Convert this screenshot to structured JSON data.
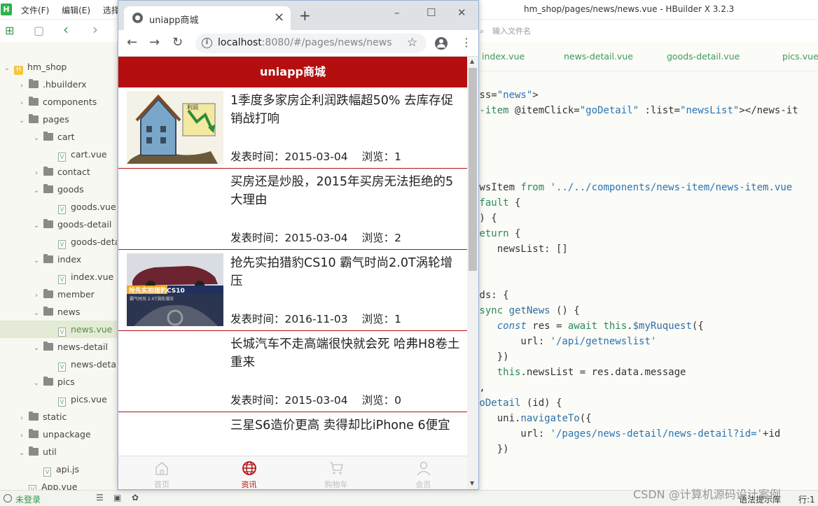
{
  "ide": {
    "menu": [
      "文件(F)",
      "编辑(E)",
      "选择(S"
    ],
    "window_title": "hm_shop/pages/news/news.vue - HBuilder X 3.2.3",
    "file_search_placeholder": "输入文件名",
    "tree": [
      {
        "label": "hm_shop",
        "type": "project",
        "depth": 0,
        "arrow": "open"
      },
      {
        "label": ".hbuilderx",
        "type": "folder",
        "depth": 1,
        "arrow": "closed"
      },
      {
        "label": "components",
        "type": "folder",
        "depth": 1,
        "arrow": "closed"
      },
      {
        "label": "pages",
        "type": "folder",
        "depth": 1,
        "arrow": "open"
      },
      {
        "label": "cart",
        "type": "folder",
        "depth": 2,
        "arrow": "open"
      },
      {
        "label": "cart.vue",
        "type": "file",
        "depth": 3
      },
      {
        "label": "contact",
        "type": "folder",
        "depth": 2,
        "arrow": "closed"
      },
      {
        "label": "goods",
        "type": "folder",
        "depth": 2,
        "arrow": "open"
      },
      {
        "label": "goods.vue",
        "type": "file",
        "depth": 3
      },
      {
        "label": "goods-detail",
        "type": "folder",
        "depth": 2,
        "arrow": "open"
      },
      {
        "label": "goods-deta",
        "type": "file",
        "depth": 3
      },
      {
        "label": "index",
        "type": "folder",
        "depth": 2,
        "arrow": "open"
      },
      {
        "label": "index.vue",
        "type": "file",
        "depth": 3
      },
      {
        "label": "member",
        "type": "folder",
        "depth": 2,
        "arrow": "closed"
      },
      {
        "label": "news",
        "type": "folder",
        "depth": 2,
        "arrow": "open"
      },
      {
        "label": "news.vue",
        "type": "file",
        "depth": 3,
        "selected": true
      },
      {
        "label": "news-detail",
        "type": "folder",
        "depth": 2,
        "arrow": "open"
      },
      {
        "label": "news-detail",
        "type": "file",
        "depth": 3
      },
      {
        "label": "pics",
        "type": "folder",
        "depth": 2,
        "arrow": "open"
      },
      {
        "label": "pics.vue",
        "type": "file",
        "depth": 3
      },
      {
        "label": "static",
        "type": "folder",
        "depth": 1,
        "arrow": "closed"
      },
      {
        "label": "unpackage",
        "type": "folder",
        "depth": 1,
        "arrow": "closed"
      },
      {
        "label": "util",
        "type": "folder",
        "depth": 1,
        "arrow": "open"
      },
      {
        "label": "api.js",
        "type": "file",
        "depth": 2
      },
      {
        "label": "App.vue",
        "type": "file",
        "depth": 1
      }
    ],
    "editor_tabs": [
      "index.vue",
      "news-detail.vue",
      "goods-detail.vue",
      "pics.vue"
    ],
    "code_lines": [
      {
        "row": 1,
        "parts": [
          [
            "pl",
            "ass="
          ],
          [
            "str",
            "\"news\""
          ],
          [
            "pl",
            ">"
          ]
        ]
      },
      {
        "row": 2,
        "parts": [
          [
            "kw",
            "s-item "
          ],
          [
            "pl",
            "@itemClick="
          ],
          [
            "str",
            "\"goDetail\""
          ],
          [
            "pl",
            " :list="
          ],
          [
            "str",
            "\"newsList\""
          ],
          [
            "pl",
            "></news-it"
          ]
        ]
      },
      {
        "row": 7,
        "parts": [
          [
            "pl",
            "ewsItem "
          ],
          [
            "kw",
            "from "
          ],
          [
            "str",
            "'../../components/news-item/news-item.vue"
          ]
        ]
      },
      {
        "row": 8,
        "parts": [
          [
            "kw",
            "efault "
          ],
          [
            "pl",
            "{"
          ]
        ]
      },
      {
        "row": 9,
        "parts": [
          [
            "pl",
            "() {"
          ]
        ]
      },
      {
        "row": 10,
        "parts": [
          [
            "kw",
            "return "
          ],
          [
            "pl",
            "{"
          ]
        ]
      },
      {
        "row": 11,
        "parts": [
          [
            "pl",
            "    newsList: []"
          ]
        ]
      },
      {
        "row": 12,
        "parts": [
          [
            "pl",
            "}"
          ]
        ]
      },
      {
        "row": 14,
        "parts": [
          [
            "pl",
            "ods: {"
          ]
        ]
      },
      {
        "row": 15,
        "parts": [
          [
            "kw",
            "async "
          ],
          [
            "fn",
            "getNews "
          ],
          [
            "pl",
            "() {"
          ]
        ]
      },
      {
        "row": 16,
        "parts": [
          [
            "it",
            "    const "
          ],
          [
            "pl",
            "res = "
          ],
          [
            "kw",
            "await "
          ],
          [
            "kw",
            "this"
          ],
          [
            "pl",
            "."
          ],
          [
            "fn",
            "$myRuquest"
          ],
          [
            "pl",
            "({"
          ]
        ]
      },
      {
        "row": 17,
        "parts": [
          [
            "pl",
            "        url: "
          ],
          [
            "str",
            "'/api/getnewslist'"
          ]
        ]
      },
      {
        "row": 18,
        "parts": [
          [
            "pl",
            "    })"
          ]
        ]
      },
      {
        "row": 19,
        "parts": [
          [
            "kw",
            "    this"
          ],
          [
            "pl",
            ".newsList = res.data.message"
          ]
        ]
      },
      {
        "row": 20,
        "parts": [
          [
            "pl",
            "},"
          ]
        ]
      },
      {
        "row": 21,
        "parts": [
          [
            "fn",
            "goDetail "
          ],
          [
            "pl",
            "(id) {"
          ]
        ]
      },
      {
        "row": 22,
        "parts": [
          [
            "pl",
            "    uni."
          ],
          [
            "fn",
            "navigateTo"
          ],
          [
            "pl",
            "({"
          ]
        ]
      },
      {
        "row": 23,
        "parts": [
          [
            "pl",
            "        url: "
          ],
          [
            "str",
            "'/pages/news-detail/news-detail?id='"
          ],
          [
            "pl",
            "+id"
          ]
        ]
      },
      {
        "row": 24,
        "parts": [
          [
            "pl",
            "    })"
          ]
        ]
      },
      {
        "row": 25,
        "parts": [
          [
            "pl",
            "}"
          ]
        ]
      }
    ],
    "status": {
      "user": "未登录",
      "hint": "语法提示库",
      "line": "行:1"
    },
    "watermark": "CSDN @计算机源码设计案例"
  },
  "browser": {
    "tab_title": "uniapp商城",
    "url_host": "localhost",
    "url_path": ":8080/#/pages/news/news"
  },
  "app": {
    "navbar_title": "uniapp商城",
    "time_prefix": "发表时间：",
    "views_prefix": "浏览：",
    "news": [
      {
        "title": "1季度多家房企利润跌幅超50% 去库存促销战打响",
        "time": "2015-03-04",
        "views": "1",
        "thumb": "house"
      },
      {
        "title": "买房还是炒股，2015年买房无法拒绝的5大理由",
        "time": "2015-03-04",
        "views": "2",
        "thumb": "none"
      },
      {
        "title": "抢先实拍猎豹CS10 霸气时尚2.0T涡轮增压",
        "time": "2016-11-03",
        "views": "1",
        "thumb": "car"
      },
      {
        "title": "长城汽车不走高端很快就会死 哈弗H8卷土重来",
        "time": "2015-03-04",
        "views": "0",
        "thumb": "none"
      },
      {
        "title": "三星S6造价更高 卖得却比iPhone 6便宜",
        "time": "",
        "views": "",
        "thumb": "none"
      }
    ],
    "tabbar": [
      {
        "label": "首页",
        "icon": "home-icon",
        "active": false
      },
      {
        "label": "资讯",
        "icon": "globe-icon",
        "active": true
      },
      {
        "label": "购物车",
        "icon": "cart-icon",
        "active": false
      },
      {
        "label": "会员",
        "icon": "user-icon",
        "active": false
      }
    ],
    "car_thumb_text": {
      "banner": "抢先实拍猎豹CS10",
      "sub": "霸气时尚 2.0T涡轮增压"
    },
    "house_thumb_text": "利润"
  }
}
